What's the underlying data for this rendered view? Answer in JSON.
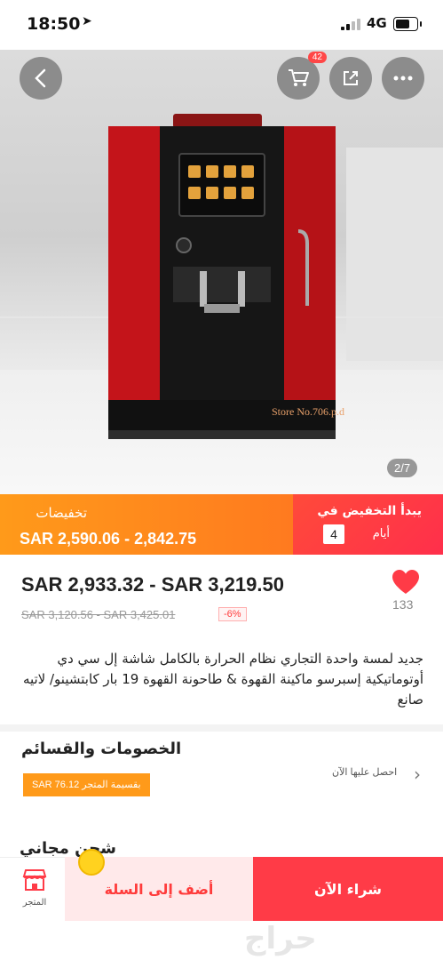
{
  "status_bar": {
    "time": "18:50",
    "network": "4G"
  },
  "header": {
    "cart_badge": "42"
  },
  "gallery": {
    "page_indicator": "2/7",
    "watermark": "Store No.706.p.d"
  },
  "promo": {
    "label": "تخفيضات",
    "price_range": "SAR 2,590.06 - 2,842.75",
    "starts_label": "يبدأ التخفيض في",
    "days_count": "4",
    "days_label": "أيام"
  },
  "product": {
    "price": "SAR 2,933.32 - SAR 3,219.50",
    "original_price": "SAR 3,120.56 - SAR 3,425.01",
    "discount_percent": "-6%",
    "likes": "133",
    "title": "جديد لمسة واحدة التجاري نظام الحرارة بالكامل شاشة إل سي دي أوتوماتيكية إسبرسو ماكينة القهوة & طاحونة القهوة 19 بار كابتشينو/ لاتيه صانع"
  },
  "coupons": {
    "title": "الخصومات والقسائم",
    "coupon_text": "SAR 76.12 بقسيمة المتجر",
    "get_link": "احصل عليها الآن"
  },
  "shipping": {
    "title": "شحن مجاني"
  },
  "bottom_bar": {
    "store_label": "المتجر",
    "add_to_cart": "أضف إلى السلة",
    "buy_now": "شراء الآن"
  },
  "footer": {
    "logo": "حراج"
  },
  "colors": {
    "accent": "#ff3b47",
    "promo_orange": "#ff8a1c",
    "heart": "#ff3b47"
  }
}
